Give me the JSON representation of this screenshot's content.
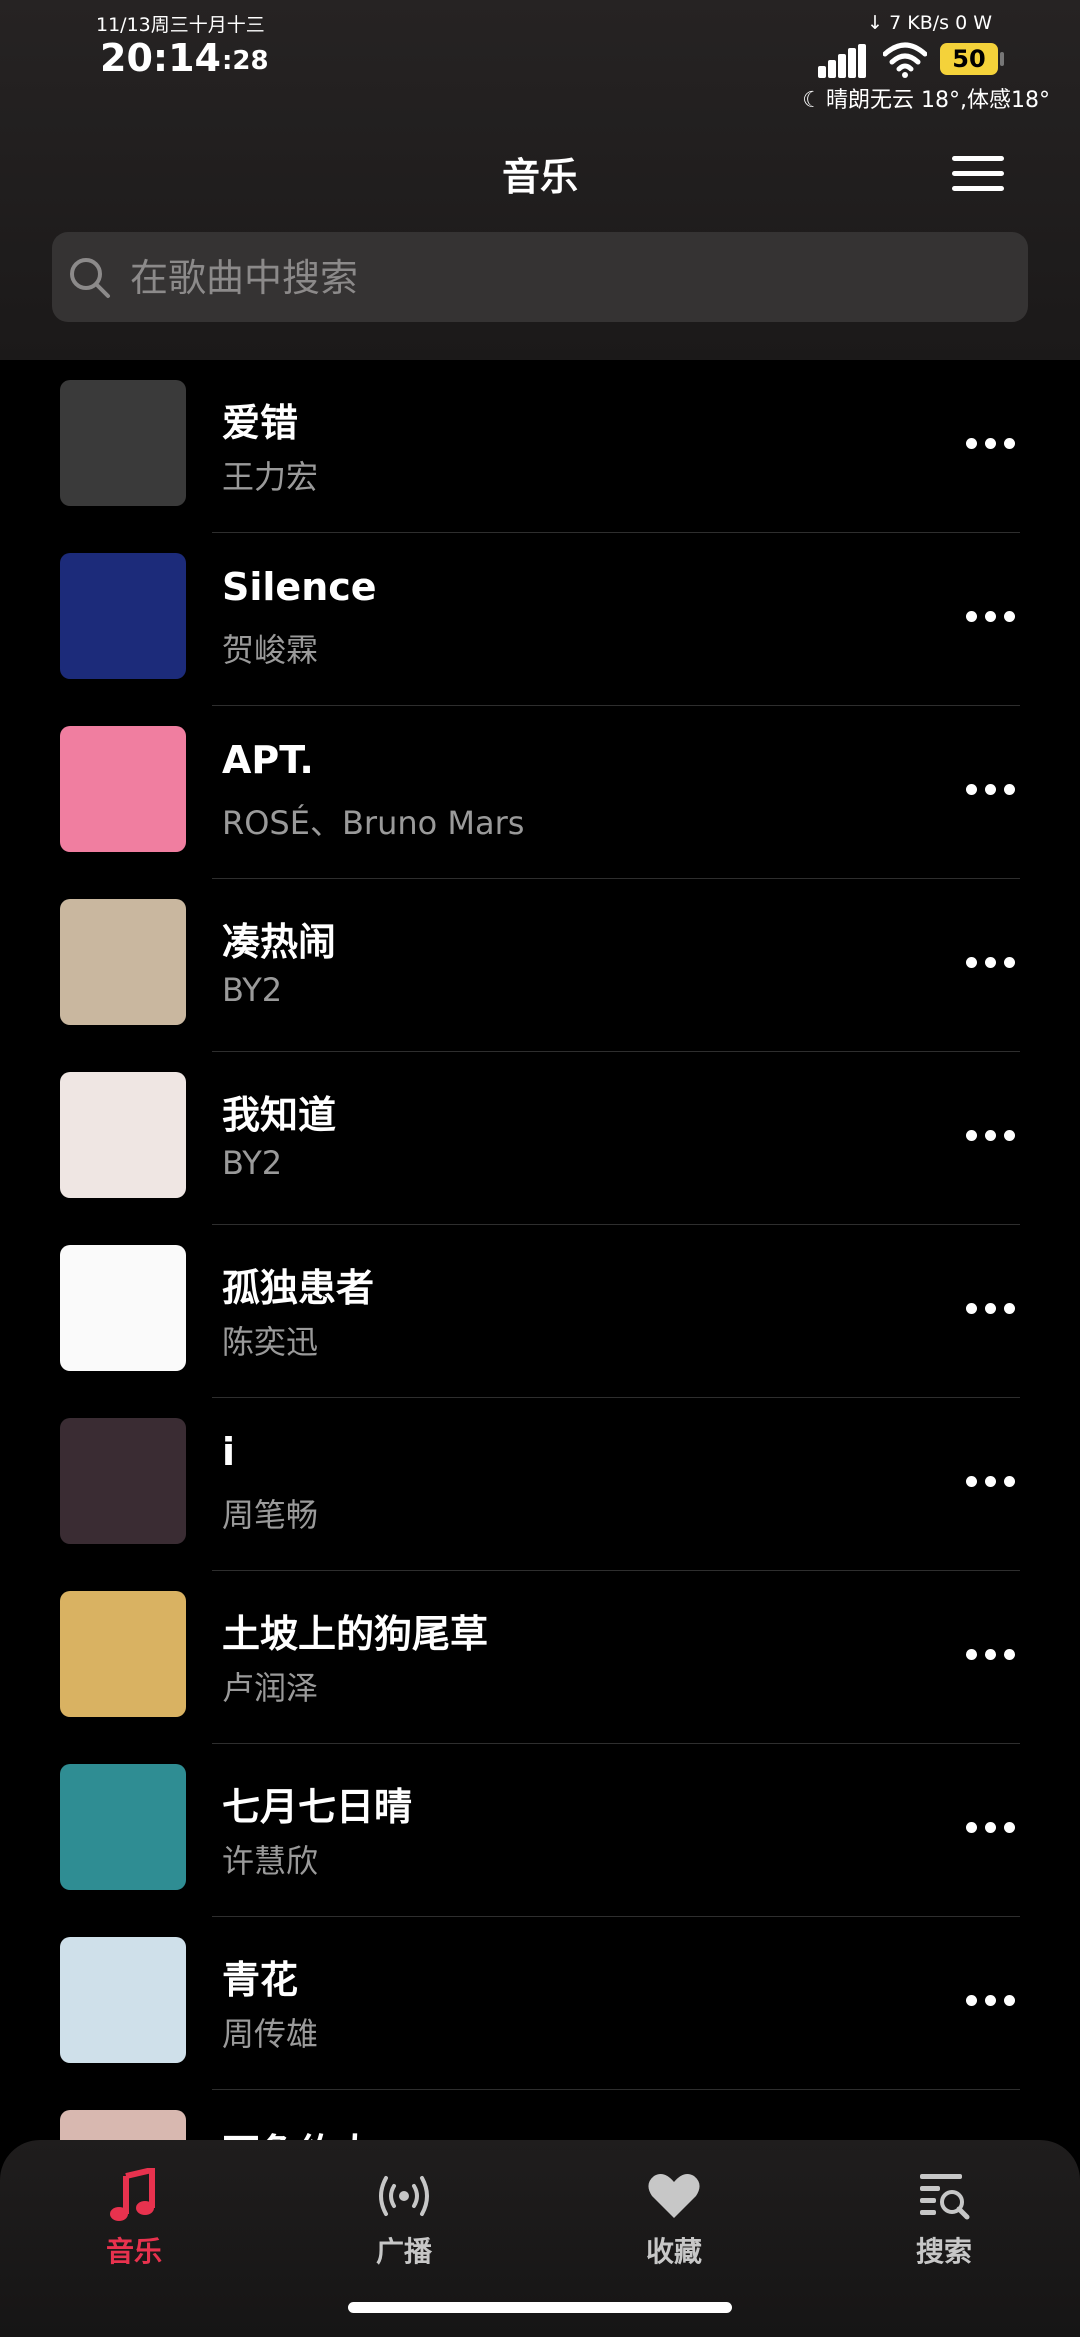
{
  "status_bar": {
    "date": "11/13周三十月十三",
    "time": "20:14",
    "seconds": ":28",
    "network_speed": "↓ 7 KB/s  0 W",
    "battery": "50",
    "weather": "晴朗无云 18°,体感18°"
  },
  "header": {
    "title": "音乐"
  },
  "search": {
    "placeholder": "在歌曲中搜索"
  },
  "songs": [
    {
      "title": "爱错",
      "artist": "王力宏",
      "cover_color": "#3a3a3a"
    },
    {
      "title": "Silence",
      "artist": "贺峻霖",
      "cover_color": "#1c2b7a"
    },
    {
      "title": "APT.",
      "artist": "ROSÉ、Bruno Mars",
      "cover_color": "#f07ea0"
    },
    {
      "title": "凑热闹",
      "artist": "BY2",
      "cover_color": "#c9b79f"
    },
    {
      "title": "我知道",
      "artist": "BY2",
      "cover_color": "#efe6e3"
    },
    {
      "title": "孤独患者",
      "artist": "陈奕迅",
      "cover_color": "#fafafa"
    },
    {
      "title": "i",
      "artist": "周笔畅",
      "cover_color": "#3a2c33"
    },
    {
      "title": "土坡上的狗尾草",
      "artist": "卢润泽",
      "cover_color": "#d9b262"
    },
    {
      "title": "七月七日晴",
      "artist": "许慧欣",
      "cover_color": "#2f8d93"
    },
    {
      "title": "青花",
      "artist": "周传雄",
      "cover_color": "#cfe0ea"
    },
    {
      "title": "不負約人",
      "artist": "",
      "cover_color": "#d8b8b0"
    }
  ],
  "tabs": [
    {
      "label": "音乐",
      "icon": "music-note-icon",
      "active": true
    },
    {
      "label": "广播",
      "icon": "broadcast-icon",
      "active": false
    },
    {
      "label": "收藏",
      "icon": "heart-icon",
      "active": false
    },
    {
      "label": "搜索",
      "icon": "list-search-icon",
      "active": false
    }
  ],
  "colors": {
    "accent": "#e8324e",
    "battery": "#f4d23a",
    "background": "#000000"
  }
}
